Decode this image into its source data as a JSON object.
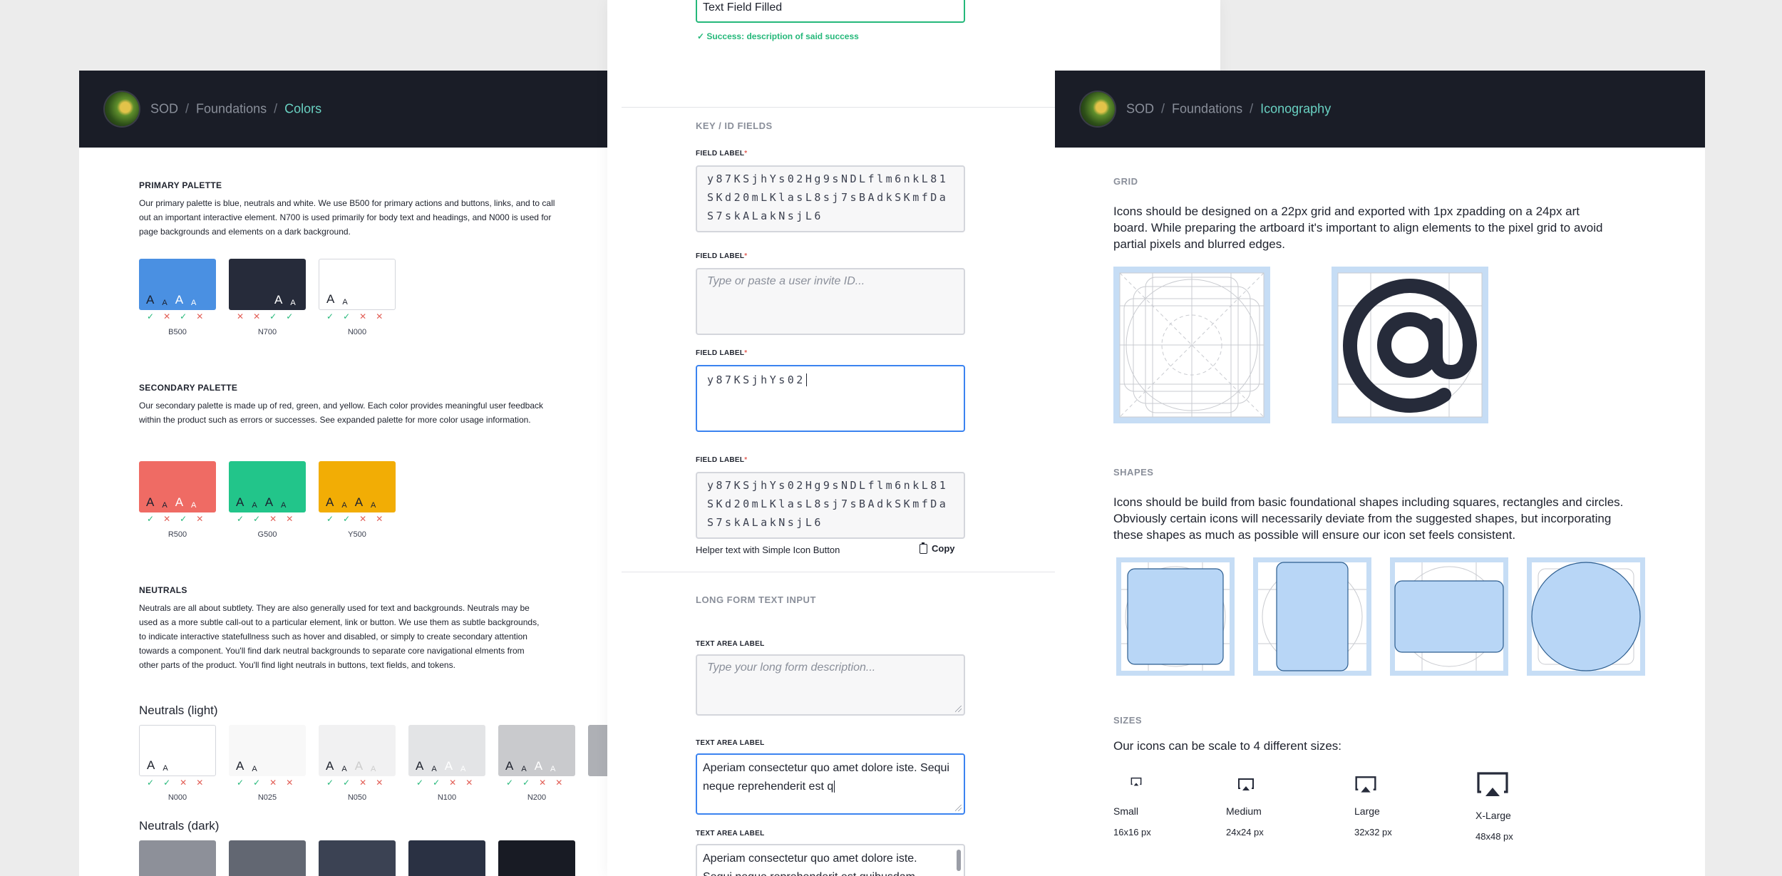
{
  "colors": {
    "b500": "#4a90e2",
    "n700": "#262b3a",
    "n000": "#ffffff",
    "r500": "#ef6b64",
    "g500": "#22c58a",
    "y500": "#f2ad05",
    "accent": "#69d1c2",
    "topbar": "#1a1d27"
  },
  "left": {
    "breadcrumb": {
      "root": "SOD",
      "section": "Foundations",
      "current": "Colors",
      "sep": "/"
    },
    "primary": {
      "title": "PRIMARY PALETTE",
      "text": "Our primary palette is blue, neutrals and white. We use B500 for primary actions and buttons, links, and to call out an important interactive element. N700 is used primarily for body text and headings, and N000 is used for page backgrounds and elements on a dark  background.",
      "swatches": [
        {
          "name": "B500",
          "aa": [
            "A",
            "A",
            "A",
            "A"
          ],
          "marks": [
            "✓",
            "✕",
            "✓",
            "✕"
          ]
        },
        {
          "name": "N700",
          "aa": [
            "A",
            "A"
          ],
          "marks": [
            "✕",
            "✕",
            "✓",
            "✓"
          ]
        },
        {
          "name": "N000",
          "aa": [
            "A",
            "A"
          ],
          "marks": [
            "✓",
            "✓",
            "✕",
            "✕"
          ]
        }
      ]
    },
    "secondary": {
      "title": "SECONDARY PALETTE",
      "text": "Our secondary palette is made up of red, green, and yellow. Each color provides meaningful user feedback within the product such as errors or successes. See expanded palette for more color usage information.",
      "swatches": [
        {
          "name": "R500",
          "aa": [
            "A",
            "A",
            "A",
            "A"
          ],
          "marks": [
            "✓",
            "✕",
            "✓",
            "✕"
          ]
        },
        {
          "name": "G500",
          "aa": [
            "A",
            "A",
            "A",
            "A"
          ],
          "marks": [
            "✓",
            "✓",
            "✕",
            "✕"
          ]
        },
        {
          "name": "Y500",
          "aa": [
            "A",
            "A",
            "A",
            "A"
          ],
          "marks": [
            "✓",
            "✓",
            "✕",
            "✕"
          ]
        }
      ]
    },
    "neutrals": {
      "title": "NEUTRALS",
      "text": "Neutrals are all about subtlety. They are also generally used for text and backgrounds. Neutrals may be used as a more subtle call-out to a particular element, link or button. We use them as subtle backgrounds, to indicate interactive statefullness such as hover and disabled, or simply to create secondary attention towards a component. You'll find dark neutral backgrounds to separate core navigational elments from other parts of the product. You'll find light neutrals in buttons, text fields, and tokens.",
      "light_title": "Neutrals (light)",
      "dark_title": "Neutrals (dark)",
      "light": [
        {
          "name": "N000",
          "color": "#ffffff",
          "marks": [
            "✓",
            "✓",
            "✕",
            "✕"
          ]
        },
        {
          "name": "N025",
          "color": "#f8f8f8",
          "marks": [
            "✓",
            "✓",
            "✕",
            "✕"
          ]
        },
        {
          "name": "N050",
          "color": "#f1f1f2",
          "marks": [
            "✓",
            "✓",
            "✕",
            "✕"
          ]
        },
        {
          "name": "N100",
          "color": "#e3e4e6",
          "marks": [
            "✓",
            "✓",
            "✕",
            "✕"
          ]
        },
        {
          "name": "N200",
          "color": "#c9cacd",
          "marks": [
            "✓",
            "✓",
            "✕",
            "✕"
          ]
        }
      ],
      "dark_colors": [
        "#8d9099",
        "#626772",
        "#3b4253",
        "#2a3143",
        "#181b24"
      ]
    }
  },
  "middle": {
    "success_field": {
      "value": "Text Field Filled",
      "message": "Success: description of said success"
    },
    "key_group": "KEY / ID FIELDS",
    "field_label": "FIELD LABEL",
    "req": "*",
    "key_value_1": "y87KSjhYs02Hg9sNDLflm6nkL81SKd20mLKlasL8sj7sBAdkSKmfDaS7skALakNsjL6",
    "key_placeholder": "Type or paste a user invite ID...",
    "key_value_partial": "y87KSjhYs02",
    "key_value_2": "y87KSjhYs02Hg9sNDLflm6nkL81SKd20mLKlasL8sj7sBAdkSKmfDaS7skALakNsjL6",
    "helper": "Helper text with Simple Icon Button",
    "copy": "Copy",
    "long_group": "LONG FORM TEXT INPUT",
    "textarea_label": "TEXT AREA LABEL",
    "textarea_placeholder": "Type your long form description...",
    "textarea_value_1": "Aperiam consectetur quo amet dolore iste. Sequi neque reprehenderit est q",
    "textarea_value_2": "Aperiam consectetur quo amet dolore iste. Sequi neque reprehenderit est quibusdam."
  },
  "right": {
    "breadcrumb": {
      "root": "SOD",
      "section": "Foundations",
      "current": "Iconography",
      "sep": "/"
    },
    "grid": {
      "title": "GRID",
      "text": "Icons should be designed on a 22px grid and exported with 1px zpadding on a 24px art board. While preparing the artboard it's important to align elements to the pixel grid to avoid partial pixels and blurred edges."
    },
    "shapes": {
      "title": "SHAPES",
      "text": "Icons should be build from basic foundational shapes including squares, rectangles and circles. Obviously certain icons will necessarily deviate from the suggested shapes, but incorporating these shapes as much as possible will ensure our icon set feels consistent."
    },
    "sizes": {
      "title": "SIZES",
      "text": "Our icons can be scale to 4 different sizes:",
      "items": [
        {
          "name": "Small",
          "px": "16x16 px"
        },
        {
          "name": "Medium",
          "px": "24x24 px"
        },
        {
          "name": "Large",
          "px": "32x32 px"
        },
        {
          "name": "X-Large",
          "px": "48x48 px"
        }
      ]
    }
  }
}
